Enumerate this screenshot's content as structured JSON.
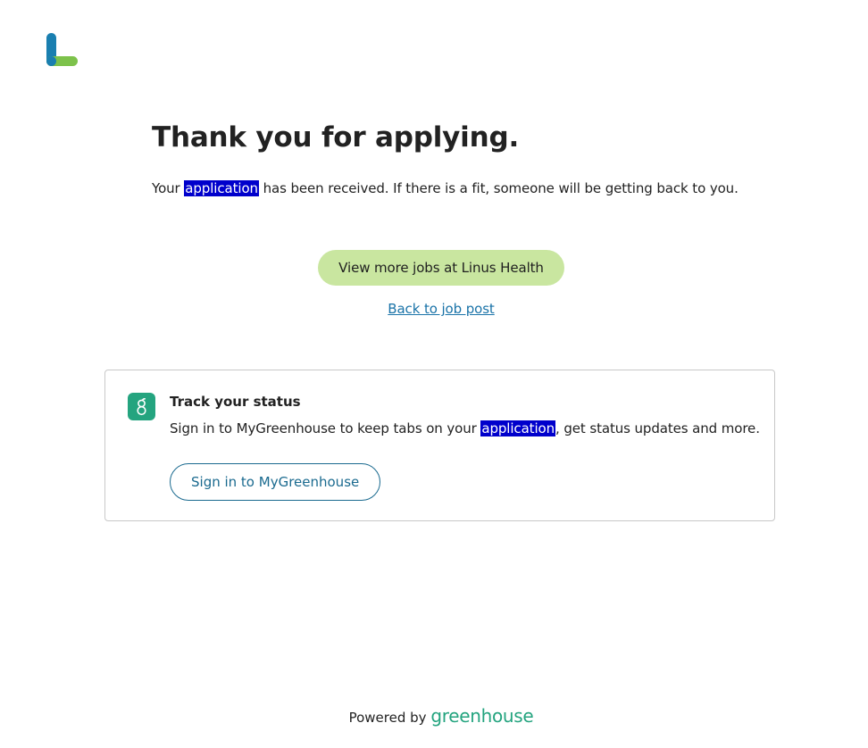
{
  "page": {
    "title": "Thank you for applying.",
    "message_before": "Your ",
    "message_highlight": "application",
    "message_after": " has been received. If there is a fit, someone will be getting back to you.",
    "primary_button": "View more jobs at Linus Health",
    "back_link": "Back to job post"
  },
  "track": {
    "title": "Track your status",
    "text_before": "Sign in to MyGreenhouse to keep tabs on your ",
    "text_highlight": "application",
    "text_after": ", get status updates and more.",
    "button": "Sign in to MyGreenhouse"
  },
  "footer": {
    "powered_by": "Powered by",
    "brand": "greenhouse"
  },
  "colors": {
    "highlight": "#0000cc",
    "primary_button_bg": "#c9e6a0",
    "link": "#1a73a8",
    "greenhouse_green": "#24a47f",
    "logo_blue": "#1a7fb0",
    "logo_green": "#7dc24b"
  },
  "icons": {
    "logo": "linus-health-logo",
    "greenhouse": "greenhouse-g-icon"
  }
}
